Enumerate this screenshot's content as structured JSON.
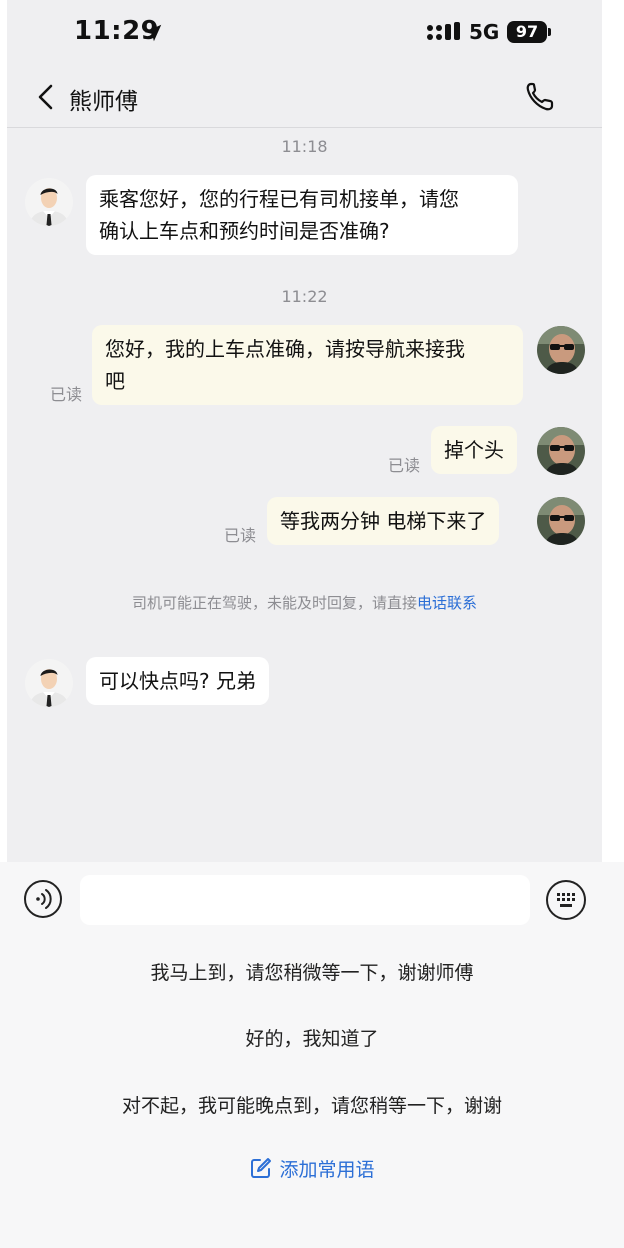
{
  "status": {
    "time": "11:29",
    "network": "5G",
    "battery": "97"
  },
  "nav": {
    "title": "熊师傅"
  },
  "messages": [
    {
      "type": "timestamp",
      "text": "11:18"
    },
    {
      "type": "incoming",
      "text_line1": "乘客您好，您的行程已有司机接单，请您",
      "text_line2": "确认上车点和预约时间是否准确?"
    },
    {
      "type": "timestamp",
      "text": "11:22"
    },
    {
      "type": "outgoing",
      "text_line1": "您好，我的上车点准确，请按导航来接我",
      "text_line2": "吧",
      "read": "已读"
    },
    {
      "type": "outgoing",
      "text": "掉个头",
      "read": "已读"
    },
    {
      "type": "outgoing",
      "text": "等我两分钟 电梯下来了",
      "read": "已读"
    },
    {
      "type": "incoming",
      "text": "可以快点吗? 兄弟"
    }
  ],
  "notice": {
    "text": "司机可能正在驾驶，未能及时回复，请直接",
    "link": "电话联系"
  },
  "input": {
    "placeholder": ""
  },
  "quick_replies": [
    "我马上到，请您稍微等一下，谢谢师傅",
    "好的，我知道了",
    "对不起，我可能晚点到，请您稍等一下，谢谢"
  ],
  "add_phrase": "添加常用语",
  "colors": {
    "accent": "#2c6fd6",
    "outgoing_bubble": "#fbf9ea",
    "chat_bg": "#efeff1"
  }
}
